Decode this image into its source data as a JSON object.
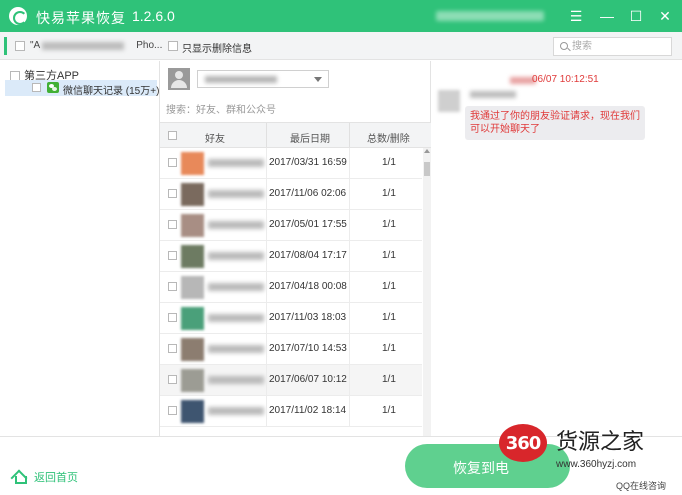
{
  "app": {
    "title": "快易苹果恢复",
    "version": "1.2.6.0",
    "colors": {
      "accent": "#2fc279",
      "time_red": "#e03a3a"
    }
  },
  "window_controls": {
    "menu": "☰",
    "minimize": "—",
    "maximize": "☐",
    "close": "✕"
  },
  "toolbar": {
    "device_prefix": "\"A",
    "device_suffix": "Pho...",
    "deleted_only_label": "只显示删除信息",
    "search_placeholder": "搜索"
  },
  "tree": {
    "root_label": "第三方APP",
    "item_label": "微信聊天记录 (15万+)"
  },
  "middle": {
    "filter_placeholder": "搜索：好友、群和公众号",
    "columns": {
      "friend": "好友",
      "last_date": "最后日期",
      "count": "总数/删除"
    },
    "rows": [
      {
        "date": "2017/03/31 16:59",
        "count": "1/1",
        "avatar": "#e8895a"
      },
      {
        "date": "2017/11/06 02:06",
        "count": "1/1",
        "avatar": "#7a6a5e"
      },
      {
        "date": "2017/05/01 17:55",
        "count": "1/1",
        "avatar": "#a88e84"
      },
      {
        "date": "2017/08/04 17:17",
        "count": "1/1",
        "avatar": "#6d7b62"
      },
      {
        "date": "2017/04/18 00:08",
        "count": "1/1",
        "avatar": "#b7b7b7"
      },
      {
        "date": "2017/11/03 18:03",
        "count": "1/1",
        "avatar": "#4aa07a"
      },
      {
        "date": "2017/07/10 14:53",
        "count": "1/1",
        "avatar": "#8c7d70"
      },
      {
        "date": "2017/06/07 10:12",
        "count": "1/1",
        "avatar": "#9c9c94"
      },
      {
        "date": "2017/11/02 18:14",
        "count": "1/1",
        "avatar": "#3e5570"
      }
    ]
  },
  "chat": {
    "time": "06/07 10:12:51",
    "message": "我通过了你的朋友验证请求，现在我们可以开始聊天了"
  },
  "bottom": {
    "back_home_label": "返回首页",
    "recover_label": "恢复到电"
  },
  "watermark": {
    "badge": "360",
    "site_name": "货源之家",
    "url": "www.360hyzj.com",
    "corner": "QQ在线咨询"
  }
}
